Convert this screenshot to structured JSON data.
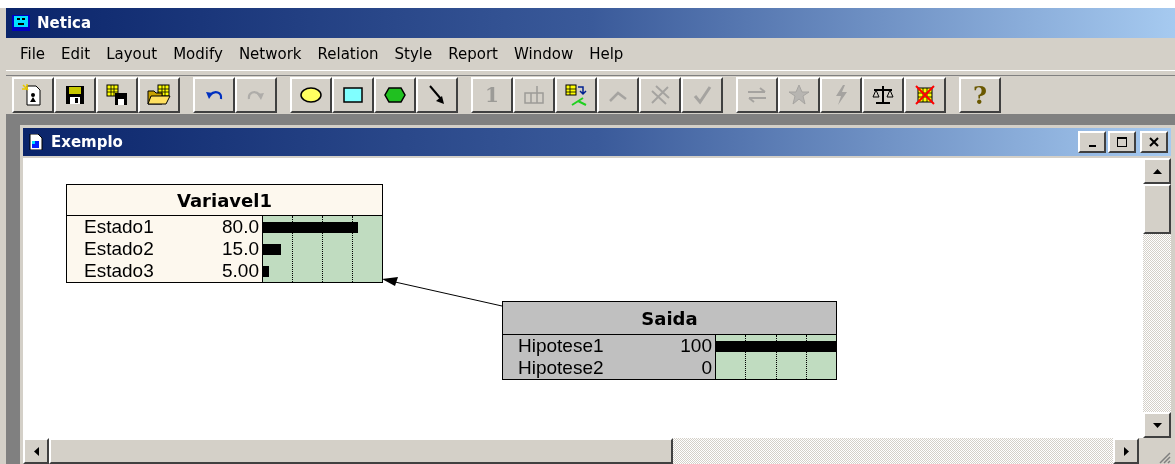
{
  "window": {
    "title": "Netica"
  },
  "menu": [
    {
      "label": "File"
    },
    {
      "label": "Edit"
    },
    {
      "label": "Layout"
    },
    {
      "label": "Modify"
    },
    {
      "label": "Network"
    },
    {
      "label": "Relation"
    },
    {
      "label": "Style"
    },
    {
      "label": "Report"
    },
    {
      "label": "Window"
    },
    {
      "label": "Help"
    }
  ],
  "toolbar": [
    {
      "buttons": [
        {
          "kind": "new",
          "disabled": false
        },
        {
          "kind": "save",
          "disabled": false
        },
        {
          "kind": "save-all",
          "disabled": false
        },
        {
          "kind": "open",
          "disabled": false
        }
      ]
    },
    {
      "buttons": [
        {
          "kind": "undo",
          "disabled": false
        },
        {
          "kind": "redo",
          "disabled": true
        }
      ]
    },
    {
      "buttons": [
        {
          "kind": "ellipse",
          "disabled": false
        },
        {
          "kind": "rectangle",
          "disabled": false
        },
        {
          "kind": "hexagon",
          "disabled": false
        },
        {
          "kind": "arrow",
          "disabled": false
        }
      ]
    },
    {
      "buttons": [
        {
          "kind": "number",
          "label": "1",
          "disabled": true
        },
        {
          "kind": "table",
          "disabled": true
        },
        {
          "kind": "tree",
          "disabled": false
        },
        {
          "kind": "caret",
          "disabled": true
        },
        {
          "kind": "crossed",
          "disabled": true
        },
        {
          "kind": "check",
          "disabled": true
        }
      ]
    },
    {
      "buttons": [
        {
          "kind": "swap",
          "disabled": true
        },
        {
          "kind": "star",
          "disabled": true
        },
        {
          "kind": "lightning",
          "disabled": true
        },
        {
          "kind": "scale",
          "disabled": false
        },
        {
          "kind": "delete-grid",
          "disabled": false
        }
      ]
    },
    {
      "buttons": [
        {
          "kind": "help",
          "label": "?",
          "disabled": false
        }
      ]
    }
  ],
  "document": {
    "title": "Exemplo",
    "nodes": [
      {
        "name": "Variavel1",
        "evidence": false,
        "states": [
          {
            "name": "Estado1",
            "value": "80.0",
            "level": 0.8
          },
          {
            "name": "Estado2",
            "value": "15.0",
            "level": 0.15
          },
          {
            "name": "Estado3",
            "value": "5.00",
            "level": 0.05
          }
        ]
      },
      {
        "name": "Saida",
        "evidence": true,
        "states": [
          {
            "name": "Hipotese1",
            "value": "100",
            "level": 1
          },
          {
            "name": "Hipotese2",
            "value": "0"
          }
        ]
      }
    ]
  }
}
